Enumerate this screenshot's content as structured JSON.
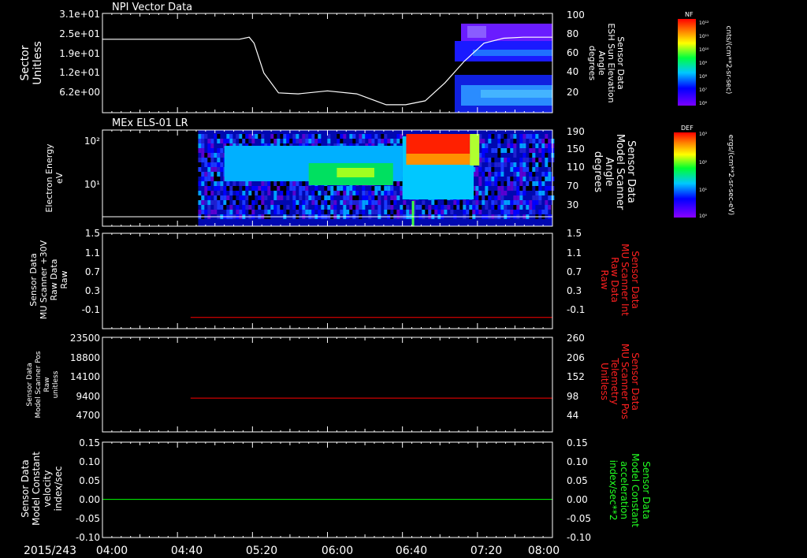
{
  "title_date": "2015/243",
  "time_ticks": [
    "04:00",
    "04:40",
    "05:20",
    "06:00",
    "06:40",
    "07:20",
    "08:00"
  ],
  "chart_data": [
    {
      "type": "line",
      "title": "NPI Vector Data",
      "ylabel": [
        "Sector",
        "Unitless"
      ],
      "left_ticks": [
        "3.1e+01",
        "2.5e+01",
        "1.9e+01",
        "1.2e+01",
        "6.2e+00"
      ],
      "right_ticks": [
        "100",
        "80",
        "60",
        "40",
        "20"
      ],
      "right_label": [
        "Sensor Data",
        "ESH Sun Elevation",
        "Angle",
        "degrees"
      ],
      "colorbar": {
        "name": "NF",
        "units": "cnts/(cm**2-sr-sec)",
        "ticks": [
          "10¹²",
          "10¹¹",
          "10¹⁰",
          "10⁹",
          "10⁸",
          "10⁷",
          "10⁶"
        ]
      },
      "right_ylim": [
        0,
        100
      ],
      "series": [
        {
          "values": [
            [
              0,
              74
            ],
            [
              140,
              74
            ],
            [
              150,
              76
            ],
            [
              155,
              70
            ],
            [
              165,
              40
            ],
            [
              180,
              20
            ],
            [
              200,
              19
            ],
            [
              230,
              22
            ],
            [
              260,
              19
            ],
            [
              290,
              8
            ],
            [
              310,
              8
            ],
            [
              330,
              12
            ],
            [
              350,
              30
            ],
            [
              370,
              52
            ],
            [
              390,
              70
            ],
            [
              410,
              75
            ],
            [
              430,
              76
            ],
            [
              460,
              76
            ]
          ]
        }
      ],
      "spectrogram_minutes": [
        347,
        480
      ]
    },
    {
      "type": "heatmap",
      "title": "MEx ELS-01 LR",
      "ylabel": [
        "Electron Energy",
        "eV"
      ],
      "left_ticks": [
        "10²",
        "10¹"
      ],
      "right_ticks": [
        "190",
        "150",
        "110",
        "70",
        "30"
      ],
      "right_label": [
        "Sensor Data",
        "Model Scanner",
        "Angle",
        "degrees"
      ],
      "colorbar": {
        "name": "DEF",
        "units": "ergs/(cm**2-sr-sec-eV)",
        "ticks": [
          "10³",
          "10²",
          "10¹",
          "10⁰"
        ]
      },
      "data_start_minutes": 51,
      "scanner_angle_deg": 10
    },
    {
      "type": "line",
      "ylabel": [
        "Sensor Data",
        "MU Scanner +30V",
        "Raw Data",
        "Raw"
      ],
      "left_ticks": [
        "1.5",
        "1.1",
        "0.7",
        "0.3",
        "-0.1"
      ],
      "right_ticks": [
        "1.5",
        "1.1",
        "0.7",
        "0.3",
        "-0.1"
      ],
      "right_label": [
        "Sensor Data",
        "MU Scanner Int",
        "Raw Data",
        "Raw"
      ],
      "ylim": [
        -0.2,
        1.5
      ],
      "series": [
        {
          "color": "#ff0000",
          "start_minutes": 47,
          "value": 0.0
        }
      ]
    },
    {
      "type": "line",
      "ylabel": [
        "Sensor Data",
        "Model Scanner Pos",
        "Raw",
        "unitless"
      ],
      "left_ticks": [
        "23500",
        "18800",
        "14100",
        "9400",
        "4700"
      ],
      "right_ticks": [
        "260",
        "206",
        "152",
        "98",
        "44"
      ],
      "right_label": [
        "Sensor Data",
        "MU Scanner Pos",
        "Telemetry",
        "Unitless"
      ],
      "right_ylim": [
        0,
        260
      ],
      "series": [
        {
          "color": "#ff0000",
          "start_minutes": 47,
          "value": 93
        }
      ]
    },
    {
      "type": "line",
      "ylabel": [
        "Sensor Data",
        "Model Constant",
        "velocity",
        "index/sec"
      ],
      "left_ticks": [
        "0.15",
        "0.10",
        "0.05",
        "0.00",
        "-0.05",
        "-0.10"
      ],
      "right_ticks": [
        "0.15",
        "0.10",
        "0.05",
        "0.00",
        "-0.05",
        "-0.10"
      ],
      "right_label": [
        "Sensor Data",
        "Model Constant",
        "acceleration",
        "index/sec**2"
      ],
      "ylim": [
        -0.1,
        0.15
      ],
      "series": [
        {
          "color": "#00ff00",
          "start_minutes": 0,
          "value": 0.0
        }
      ]
    }
  ]
}
